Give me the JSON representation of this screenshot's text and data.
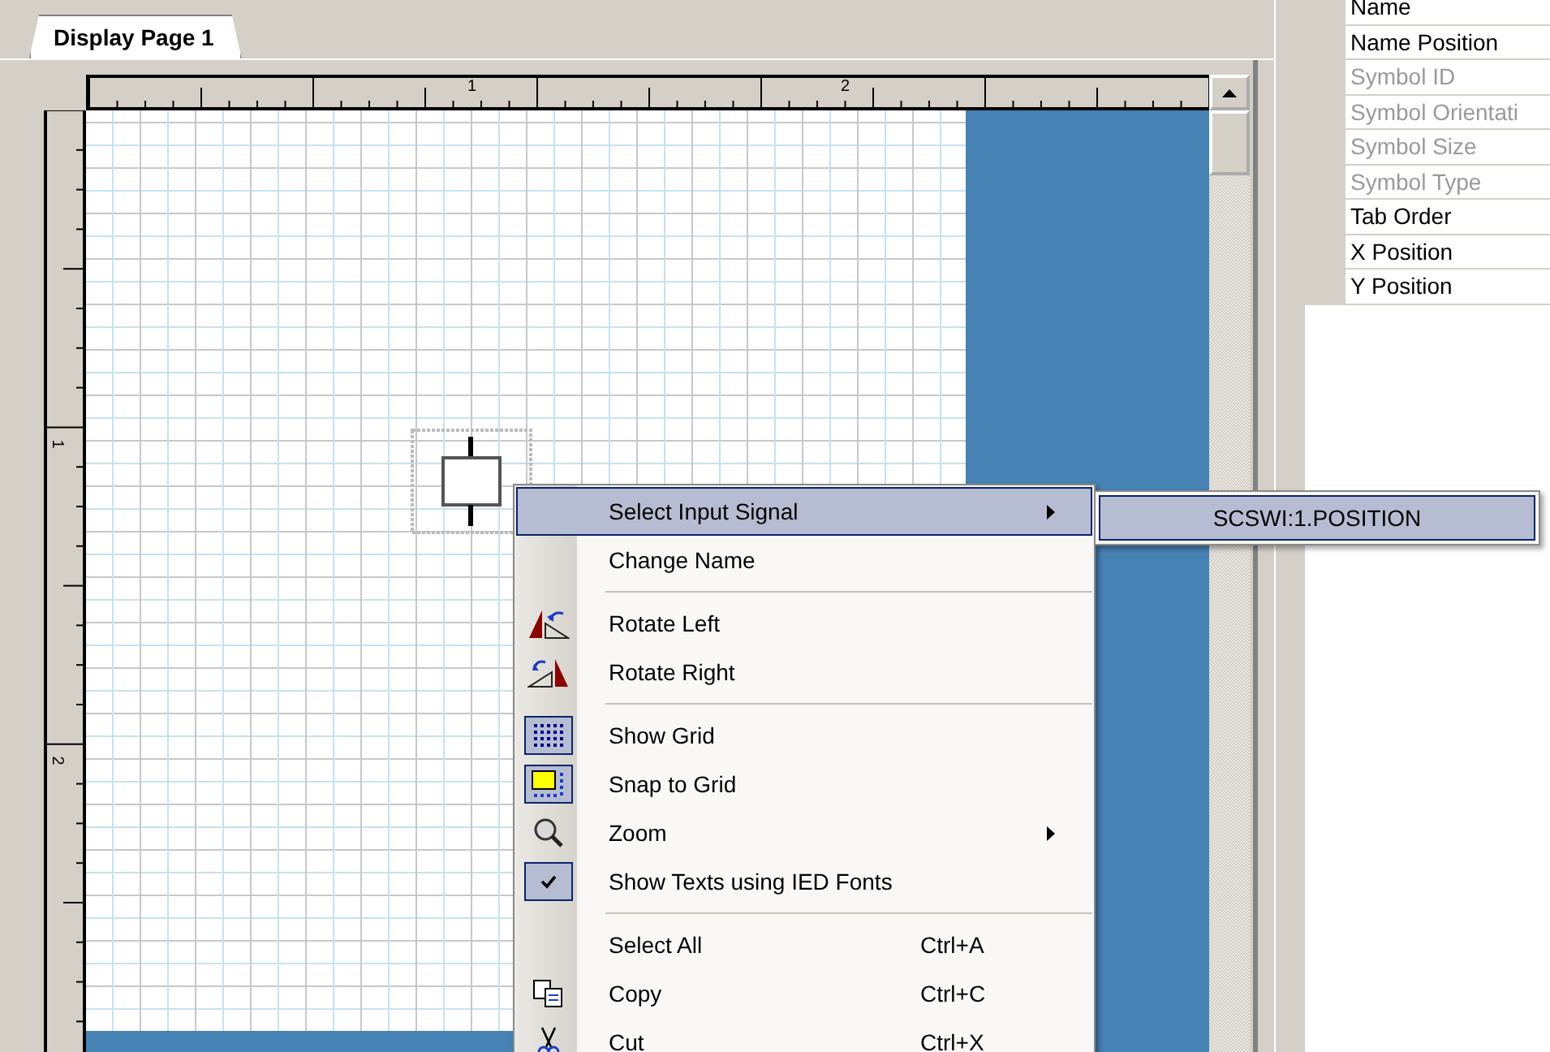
{
  "tabs": [
    {
      "label": "Display Page 1",
      "selected": true
    }
  ],
  "ruler": {
    "top_labels": [
      "1",
      "2"
    ],
    "left_labels": [
      "1",
      "2"
    ]
  },
  "properties": [
    {
      "label": "Name",
      "disabled": false
    },
    {
      "label": "Name Position",
      "disabled": false
    },
    {
      "label": "Symbol ID",
      "disabled": true
    },
    {
      "label": "Symbol Orientati",
      "disabled": true
    },
    {
      "label": "Symbol Size",
      "disabled": true
    },
    {
      "label": "Symbol Type",
      "disabled": true
    },
    {
      "label": "Tab Order",
      "disabled": false
    },
    {
      "label": "X Position",
      "disabled": false
    },
    {
      "label": "Y Position",
      "disabled": false
    }
  ],
  "context_menu": {
    "items": [
      {
        "kind": "item",
        "label": "Select Input Signal",
        "submenu": true,
        "selected": true,
        "checked": false
      },
      {
        "kind": "item",
        "label": "Change Name",
        "submenu": false,
        "selected": false,
        "checked": false
      },
      {
        "kind": "separator"
      },
      {
        "kind": "item",
        "label": "Rotate Left",
        "submenu": false,
        "selected": false,
        "checked": false
      },
      {
        "kind": "item",
        "label": "Rotate Right",
        "submenu": false,
        "selected": false,
        "checked": false
      },
      {
        "kind": "separator"
      },
      {
        "kind": "item",
        "label": "Show Grid",
        "submenu": false,
        "selected": false,
        "checked": true
      },
      {
        "kind": "item",
        "label": "Snap to Grid",
        "submenu": false,
        "selected": false,
        "checked": true
      },
      {
        "kind": "item",
        "label": "Zoom",
        "submenu": true,
        "selected": false,
        "checked": false
      },
      {
        "kind": "item",
        "label": "Show Texts using IED Fonts",
        "submenu": false,
        "selected": false,
        "checked": true
      },
      {
        "kind": "separator"
      },
      {
        "kind": "item",
        "label": "Select All",
        "shortcut": "Ctrl+A",
        "submenu": false,
        "selected": false,
        "checked": false
      },
      {
        "kind": "item",
        "label": "Copy",
        "shortcut": "Ctrl+C",
        "submenu": false,
        "selected": false,
        "checked": false
      },
      {
        "kind": "item",
        "label": "Cut",
        "shortcut": "Ctrl+X",
        "submenu": false,
        "selected": false,
        "checked": false
      }
    ],
    "submenu": {
      "items": [
        {
          "label": "SCSWI:1.POSITION",
          "selected": true
        }
      ]
    }
  }
}
